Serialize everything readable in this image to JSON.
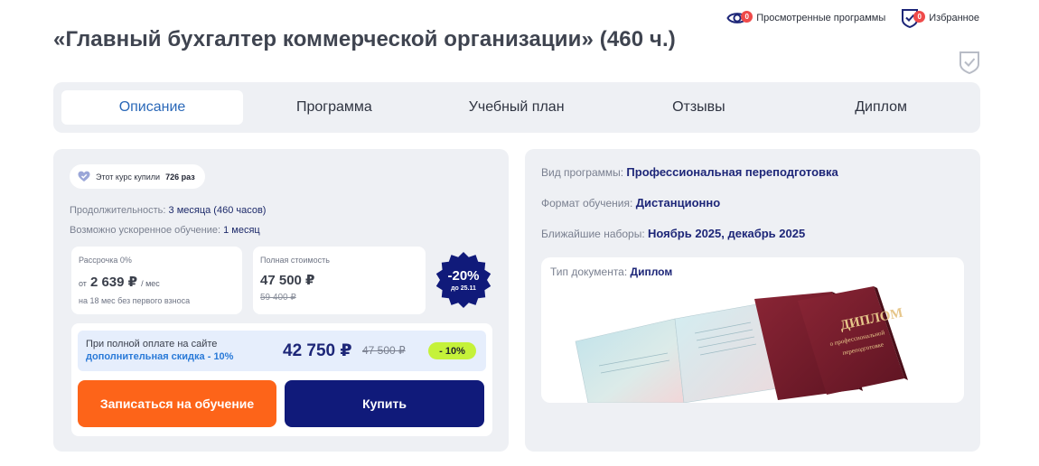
{
  "header": {
    "viewed_label": "Просмотренные программы",
    "viewed_count": "0",
    "favorites_label": "Избранное",
    "favorites_count": "0",
    "title": "«Главный бухгалтер коммерческой организации» (460 ч.)"
  },
  "tabs": [
    {
      "label": "Описание",
      "active": true
    },
    {
      "label": "Программа",
      "active": false
    },
    {
      "label": "Учебный план",
      "active": false
    },
    {
      "label": "Отзывы",
      "active": false
    },
    {
      "label": "Диплом",
      "active": false
    }
  ],
  "purchase": {
    "bought_prefix": "Этот курс купили",
    "bought_count": "726 раз",
    "duration_label": "Продолжительность:",
    "duration_value": "3 месяца (460 часов)",
    "accelerated_label": "Возможно ускоренное обучение:",
    "accelerated_value": "1 месяц",
    "installment": {
      "label": "Рассрочка 0%",
      "prefix": "от",
      "amount": "2 639 ₽",
      "per": "/ мес",
      "note": "на 18 мес без первого взноса"
    },
    "full_price": {
      "label": "Полная стоимость",
      "amount": "47 500 ₽",
      "old_amount": "59 400 ₽"
    },
    "discount_badge": {
      "percent": "-20%",
      "until": "до 25.11"
    },
    "full_payment": {
      "line1": "При полной оплате на сайте",
      "line2": "дополнительная скидка - 10%",
      "price": "42 750 ₽",
      "old_price": "47 500 ₽",
      "pill": "- 10%"
    },
    "enroll_button": "Записаться на обучение",
    "buy_button": "Купить"
  },
  "program_info": {
    "type_label": "Вид программы:",
    "type_value": "Профессиональная переподготовка",
    "format_label": "Формат обучения:",
    "format_value": "Дистанционно",
    "intake_label": "Ближайшие наборы:",
    "intake_value": "Ноябрь 2025, декабрь 2025",
    "document_label": "Тип документа:",
    "document_value": "Диплом",
    "diploma_cover_title": "ДИПЛОМ",
    "diploma_cover_sub1": "о профессиональной",
    "diploma_cover_sub2": "переподготовке"
  },
  "colors": {
    "accent_blue": "#2a68b8",
    "dark_navy": "#101a7a",
    "orange": "#fd6419",
    "lime": "#c5f23a",
    "badge_red": "#ef4a4a",
    "card_bg": "#eef0f4",
    "diploma_burgundy": "#7a1f2e"
  },
  "icons": {
    "viewed": "eye-icon",
    "favorites": "shield-check-icon",
    "bought": "heart-badge-icon",
    "save_toggle": "shield-check-outline-icon"
  }
}
